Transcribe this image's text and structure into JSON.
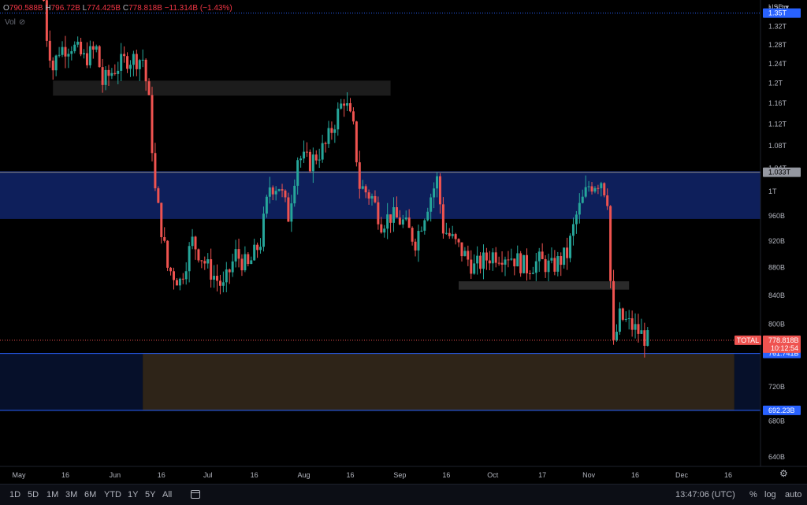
{
  "legend": {
    "o_label": "O",
    "o": "790.588B",
    "h_label": "H",
    "h": "796.72B",
    "l_label": "L",
    "l": "774.425B",
    "c_label": "C",
    "c": "778.818B",
    "change": "−11.314B (−1.43%)",
    "vol_label": "Vol"
  },
  "colors": {
    "up": "#26a69a",
    "down": "#ef5350",
    "zone_blue": "#0e1f5b",
    "zone_brown": "#2e2418",
    "zone_navy": "#06102a",
    "bar_gray": "#2a2a2a"
  },
  "chart_data": {
    "type": "candlestick",
    "y_scale": "log",
    "ylim": [
      630000000000,
      1380000000000
    ],
    "currency": "USD",
    "y_ticks": [
      "1.36T",
      "1.32T",
      "1.28T",
      "1.24T",
      "1.2T",
      "1.16T",
      "1.12T",
      "1.08T",
      "1.04T",
      "1T",
      "960B",
      "920B",
      "880B",
      "840B",
      "800B",
      "760B",
      "720B",
      "680B",
      "640B"
    ],
    "y_tick_values": [
      1360,
      1320,
      1280,
      1240,
      1200,
      1160,
      1120,
      1080,
      1040,
      1000,
      960,
      920,
      880,
      840,
      800,
      760,
      720,
      680,
      640
    ],
    "x_ticks": [
      {
        "label": "May",
        "date": "2022-05-01"
      },
      {
        "label": "16",
        "date": "2022-05-16"
      },
      {
        "label": "Jun",
        "date": "2022-06-01"
      },
      {
        "label": "16",
        "date": "2022-06-16"
      },
      {
        "label": "Jul",
        "date": "2022-07-01"
      },
      {
        "label": "16",
        "date": "2022-07-16"
      },
      {
        "label": "Aug",
        "date": "2022-08-01"
      },
      {
        "label": "16",
        "date": "2022-08-16"
      },
      {
        "label": "Sep",
        "date": "2022-09-01"
      },
      {
        "label": "16",
        "date": "2022-09-16"
      },
      {
        "label": "Oct",
        "date": "2022-10-01"
      },
      {
        "label": "17",
        "date": "2022-10-17"
      },
      {
        "label": "Nov",
        "date": "2022-11-01"
      },
      {
        "label": "16",
        "date": "2022-11-16"
      },
      {
        "label": "Dec",
        "date": "2022-12-01"
      },
      {
        "label": "16",
        "date": "2022-12-16"
      }
    ],
    "series_name": "TOTAL",
    "path_anchors": [
      [
        "2022-05-09",
        1380
      ],
      [
        "2022-05-10",
        1300
      ],
      [
        "2022-05-12",
        1230
      ],
      [
        "2022-05-14",
        1270
      ],
      [
        "2022-05-18",
        1280
      ],
      [
        "2022-05-22",
        1250
      ],
      [
        "2022-05-26",
        1270
      ],
      [
        "2022-05-28",
        1200
      ],
      [
        "2022-06-01",
        1230
      ],
      [
        "2022-06-05",
        1250
      ],
      [
        "2022-06-10",
        1250
      ],
      [
        "2022-06-12",
        1160
      ],
      [
        "2022-06-14",
        1000
      ],
      [
        "2022-06-18",
        880
      ],
      [
        "2022-06-22",
        860
      ],
      [
        "2022-06-26",
        920
      ],
      [
        "2022-07-01",
        880
      ],
      [
        "2022-07-06",
        850
      ],
      [
        "2022-07-10",
        900
      ],
      [
        "2022-07-14",
        880
      ],
      [
        "2022-07-18",
        920
      ],
      [
        "2022-07-21",
        1010
      ],
      [
        "2022-07-24",
        1010
      ],
      [
        "2022-07-27",
        960
      ],
      [
        "2022-07-30",
        1060
      ],
      [
        "2022-08-03",
        1050
      ],
      [
        "2022-08-08",
        1080
      ],
      [
        "2022-08-12",
        1140
      ],
      [
        "2022-08-14",
        1170
      ],
      [
        "2022-08-17",
        1110
      ],
      [
        "2022-08-19",
        1010
      ],
      [
        "2022-08-23",
        990
      ],
      [
        "2022-08-26",
        950
      ],
      [
        "2022-08-29",
        960
      ],
      [
        "2022-09-02",
        950
      ],
      [
        "2022-09-06",
        920
      ],
      [
        "2022-09-10",
        980
      ],
      [
        "2022-09-13",
        1020
      ],
      [
        "2022-09-15",
        940
      ],
      [
        "2022-09-20",
        910
      ],
      [
        "2022-09-25",
        880
      ],
      [
        "2022-10-01",
        900
      ],
      [
        "2022-10-06",
        900
      ],
      [
        "2022-10-12",
        880
      ],
      [
        "2022-10-16",
        890
      ],
      [
        "2022-10-20",
        880
      ],
      [
        "2022-10-25",
        900
      ],
      [
        "2022-10-28",
        960
      ],
      [
        "2022-11-01",
        1010
      ],
      [
        "2022-11-05",
        1020
      ],
      [
        "2022-11-07",
        990
      ],
      [
        "2022-11-08",
        860
      ],
      [
        "2022-11-09",
        770
      ],
      [
        "2022-11-11",
        810
      ],
      [
        "2022-11-14",
        800
      ],
      [
        "2022-11-17",
        790
      ],
      [
        "2022-11-20",
        779
      ]
    ],
    "last": {
      "close": 778.818
    }
  },
  "levels": [
    {
      "value": 1350,
      "label": "1.35T",
      "style": "dotted",
      "color": "#2962ff"
    },
    {
      "value": 1033,
      "label": "1.033T",
      "style": "solid",
      "color": "#888"
    },
    {
      "value": 761.741,
      "label": "761.741B",
      "style": "solid",
      "color": "#2962ff"
    },
    {
      "value": 692.23,
      "label": "692.23B",
      "style": "solid",
      "color": "#2962ff"
    }
  ],
  "zones": [
    {
      "name": "zone-resistance-blue",
      "from": "2022-05-01",
      "to": "2022-12-31",
      "low": 955,
      "high": 1035,
      "color": "#0e1f5b"
    },
    {
      "name": "zone-support-navy",
      "from": "2022-05-01",
      "to": "2022-06-10",
      "low": 692,
      "high": 762,
      "color": "#06102a"
    },
    {
      "name": "zone-support-brown",
      "from": "2022-06-10",
      "to": "2022-12-18",
      "low": 692,
      "high": 762,
      "color": "#2e2418"
    },
    {
      "name": "zone-support-navy-right",
      "from": "2022-12-18",
      "to": "2022-12-31",
      "low": 692,
      "high": 762,
      "color": "#06102a"
    },
    {
      "name": "zone-gray-top",
      "from": "2022-05-12",
      "to": "2022-08-29",
      "low": 1175,
      "high": 1205,
      "color": "#1c1c1c"
    },
    {
      "name": "zone-gray-mid",
      "from": "2022-09-20",
      "to": "2022-11-14",
      "low": 848,
      "high": 860,
      "color": "#2a2a2a"
    }
  ],
  "price_tags": [
    {
      "label": "TOTAL",
      "color": "#ef5350",
      "value": 779
    },
    {
      "label": "778.818B",
      "color": "#ef5350",
      "value": 779
    },
    {
      "label": "10:12:54",
      "color": "#ef5350",
      "value": 770
    }
  ],
  "toolbar": {
    "timeframes": [
      "1D",
      "5D",
      "1M",
      "3M",
      "6M",
      "YTD",
      "1Y",
      "5Y",
      "All"
    ],
    "time": "13:47:06 (UTC)",
    "percent": "%",
    "log": "log",
    "auto": "auto",
    "currency_label": "USD"
  }
}
